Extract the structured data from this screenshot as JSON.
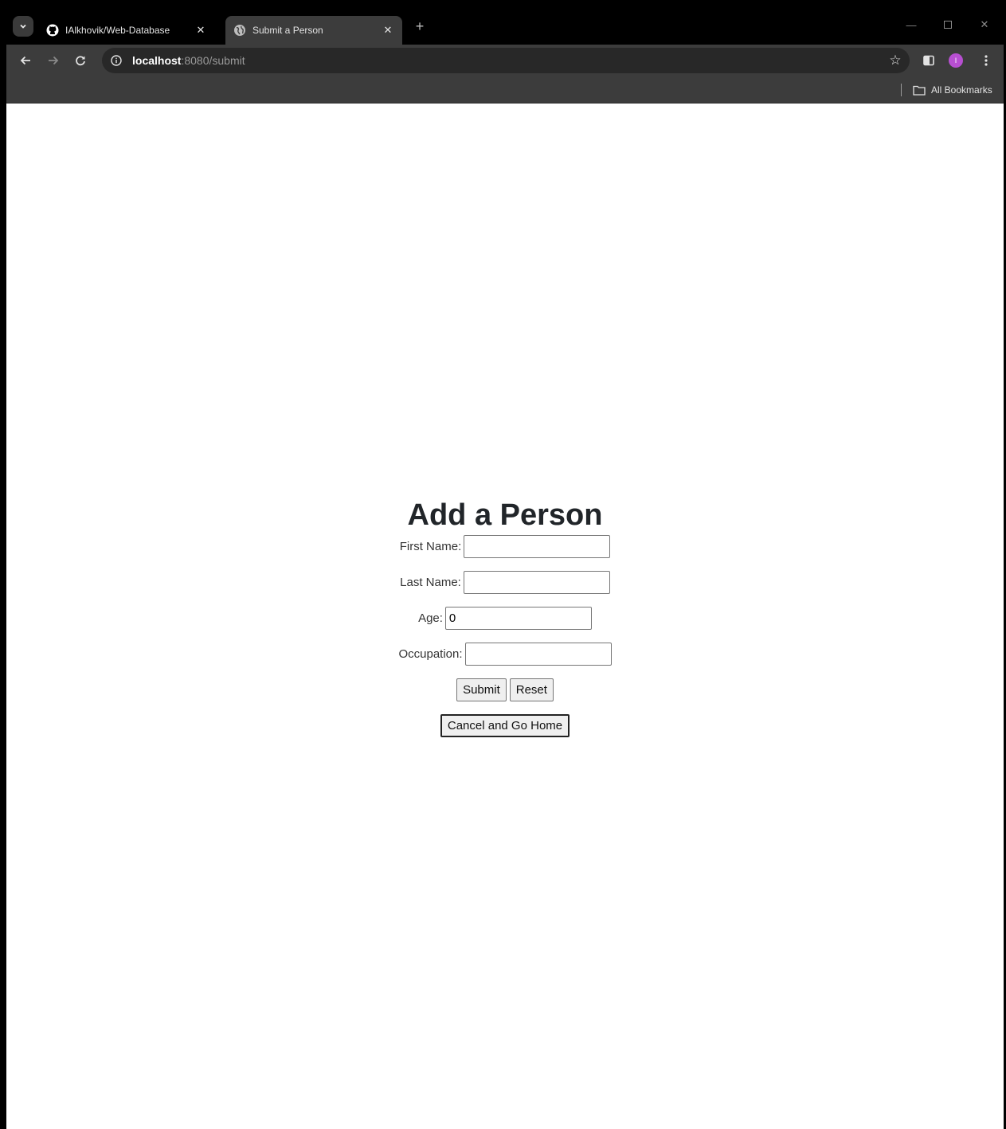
{
  "browser": {
    "tabs": [
      {
        "title": "IAlkhovik/Web-Database",
        "icon": "github-icon",
        "active": false
      },
      {
        "title": "Submit a Person",
        "icon": "globe-icon",
        "active": true
      }
    ],
    "new_tab_label": "+",
    "address": {
      "host": "localhost",
      "rest": ":8080/submit"
    },
    "avatar_letter": "I",
    "avatar_color": "#b74fd1",
    "bookmarks": {
      "all_bookmarks_label": "All Bookmarks"
    }
  },
  "page": {
    "title": "Add a Person",
    "fields": {
      "first_name": {
        "label": "First Name:",
        "value": ""
      },
      "last_name": {
        "label": "Last Name:",
        "value": ""
      },
      "age": {
        "label": "Age:",
        "value": "0"
      },
      "occupation": {
        "label": "Occupation:",
        "value": ""
      }
    },
    "buttons": {
      "submit": "Submit",
      "reset": "Reset",
      "cancel_home": "Cancel and Go Home"
    }
  }
}
